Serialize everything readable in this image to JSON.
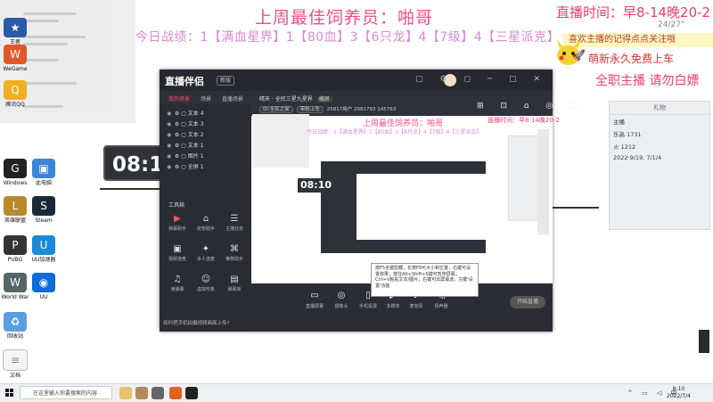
{
  "overlay": {
    "title": "上周最佳饲养员：啪哥",
    "subtitle": "今日战绩：1【满血星界】1【80血】3【6只龙】4【7级】4【三星派克】",
    "live_time": "直播时间：早8-14晚20-2",
    "warning": "全职主播 请勿白嫖",
    "ticker": "喜欢主播的记得点点关注哦",
    "lead": "萌新永久免费上车",
    "weather": "24/27°"
  },
  "desktop_icons": [
    {
      "label": "王者",
      "color": "#2b5aa8",
      "glyph": "★"
    },
    {
      "label": "WeGame",
      "color": "#e0582a",
      "glyph": "W"
    },
    {
      "label": "腾讯QQ",
      "color": "#f0b020",
      "glyph": "Q"
    },
    {
      "label": "Windows",
      "color": "#222",
      "glyph": "G"
    },
    {
      "label": "此电脑",
      "color": "#3b86d8",
      "glyph": "▣"
    },
    {
      "label": "英雄联盟",
      "color": "#b88a2a",
      "glyph": "L"
    },
    {
      "label": "Steam",
      "color": "#1b2838",
      "glyph": "S"
    },
    {
      "label": "PUBG",
      "color": "#333",
      "glyph": "P"
    },
    {
      "label": "UU加速器",
      "color": "#1b8ad8",
      "glyph": "U"
    },
    {
      "label": "World War",
      "color": "#566",
      "glyph": "W"
    },
    {
      "label": "UU",
      "color": "#0e6bd8",
      "glyph": "◉"
    },
    {
      "label": "回收站",
      "color": "#5c9fe0",
      "glyph": "♻"
    },
    {
      "label": "文档",
      "color": "#888",
      "glyph": "≡"
    }
  ],
  "clock": {
    "time": "08:10"
  },
  "app": {
    "name": "直播伴侣",
    "version": "新版",
    "scene_tabs": [
      "我的场景",
      "场景",
      "直播场景"
    ],
    "sources": [
      "文本 4",
      "文本 3",
      "文本 2",
      "文本 1",
      "图片 1",
      "全屏 1"
    ],
    "tools_title": "工具箱",
    "tools": [
      {
        "label": "弹幕助手",
        "icon": "danmaku-icon"
      },
      {
        "label": "房管助手",
        "icon": "manager-icon"
      },
      {
        "label": "主播任务",
        "icon": "task-icon"
      },
      {
        "label": "视频连麦",
        "icon": "video-icon"
      },
      {
        "label": "多人连麦",
        "icon": "multi-icon"
      },
      {
        "label": "推荐助手",
        "icon": "recommend-icon"
      },
      {
        "label": "读弹幕",
        "icon": "read-icon"
      },
      {
        "label": "虚拟形象",
        "icon": "avatar-icon"
      },
      {
        "label": "弹幕库",
        "icon": "library-icon"
      }
    ],
    "hint": "如何把手机拍摄视频画面上传?",
    "preview_header": {
      "text": "晴天 · 全民三星九星界",
      "pill": "横屏"
    },
    "preview_header2": {
      "pill1": "ID:全民之家",
      "pill2": "带粉上车",
      "stats": "25817用户  2081793  145763"
    },
    "bottom_tools": [
      "直播屏幕",
      "摄像头",
      "手机投屏",
      "多媒体",
      "麦克风",
      "扬声器"
    ],
    "start_label": "开始直播",
    "tooltip": "按F5全键隐藏，长按F8可大小和位置，右键可设置效果；按住Alt+Shift+S键可暂停屏幕；Ctrl+V粘贴文本/图片；右键可出屏幕选，左键'设置'功能"
  },
  "nested": {
    "title": "上周最佳饲养员：啪哥",
    "subtitle": "今日战绩：1【满血星界】1【80血】3【6只龙】4【7级】4【三星派克】",
    "live": "直播时间：早8-14晚20-2",
    "clock": "08:10"
  },
  "gift_panel": {
    "title": "礼物",
    "rows": [
      "主播",
      "乐高 1731",
      "火 1212",
      "2022·9/19, 7/1/4"
    ]
  },
  "taskbar": {
    "search_placeholder": "在这里输入你要搜索的内容",
    "time": "8:10",
    "date": "2022/7/4"
  }
}
